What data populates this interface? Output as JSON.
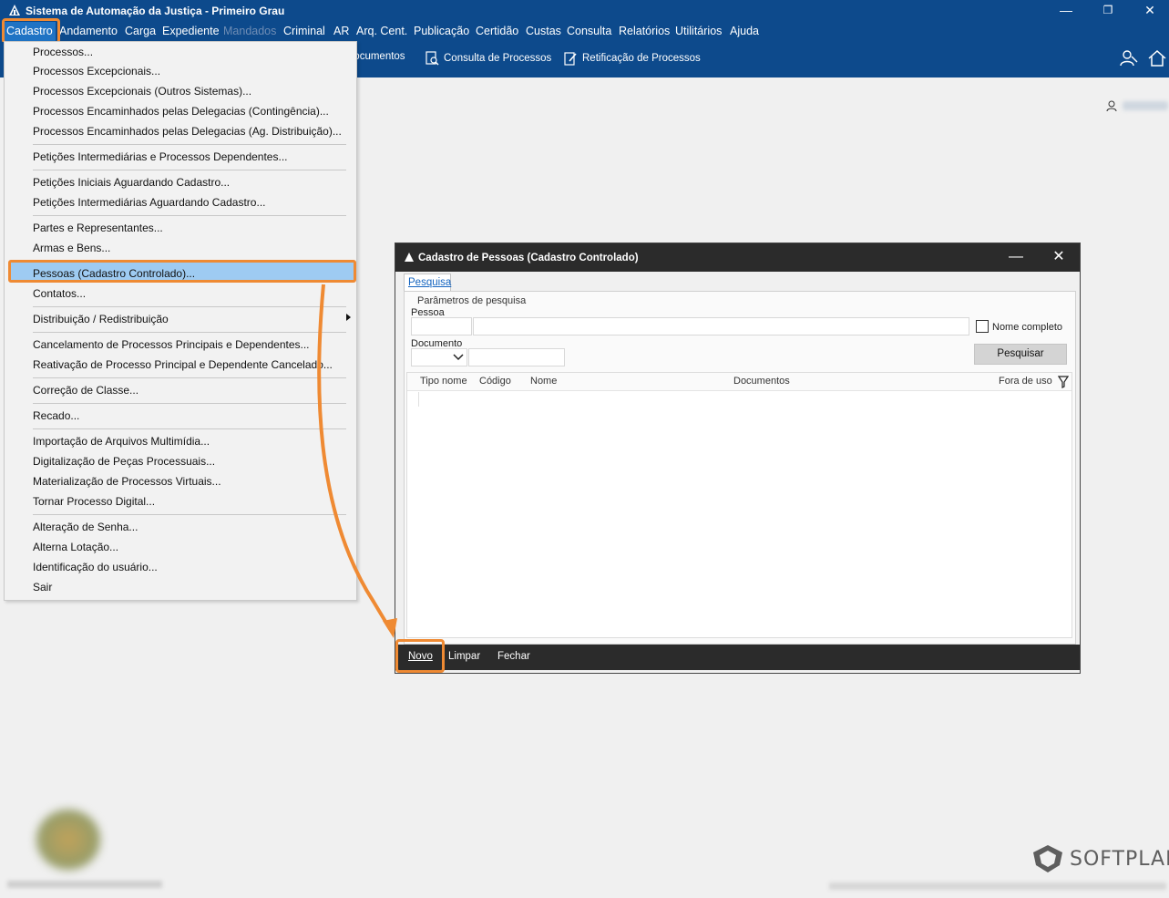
{
  "window": {
    "title": "Sistema de Automação da Justiça - Primeiro Grau",
    "controls": [
      "—",
      "❐",
      "✕"
    ]
  },
  "menubar": {
    "items": [
      "Cadastro",
      "Andamento",
      "Carga",
      "Expediente",
      "Mandados",
      "Criminal",
      "AR",
      "Arq. Cent.",
      "Publicação",
      "Certidão",
      "Custas",
      "Consulta",
      "Relatórios",
      "Utilitários",
      "Ajuda"
    ]
  },
  "toolbar": {
    "items": [
      "Documentos",
      "Consulta de Processos",
      "Retificação de Processos"
    ]
  },
  "dropdown": {
    "items": [
      "Processos...",
      "Processos Excepcionais...",
      "Processos Excepcionais (Outros Sistemas)...",
      "Processos Encaminhados pelas Delegacias (Contingência)...",
      "Processos Encaminhados pelas Delegacias (Ag. Distribuição)...",
      "Petições Intermediárias e Processos Dependentes...",
      "Petições Iniciais Aguardando Cadastro...",
      "Petições Intermediárias Aguardando Cadastro...",
      "Partes e Representantes...",
      "Armas e Bens...",
      "Pessoas (Cadastro Controlado)...",
      "Contatos...",
      "Distribuição / Redistribuição",
      "Cancelamento de Processos Principais e Dependentes...",
      "Reativação de Processo Principal e Dependente Cancelado...",
      "Correção de Classe...",
      "Recado...",
      "Importação de Arquivos Multimídia...",
      "Digitalização de Peças Processuais...",
      "Materialização de Processos Virtuais...",
      "Tornar Processo Digital...",
      "Alteração de Senha...",
      "Alterna Lotação...",
      "Identificação do usuário...",
      "Sair"
    ]
  },
  "dialog": {
    "title": "Cadastro de Pessoas (Cadastro Controlado)",
    "tab": "Pesquisa",
    "group": "Parâmetros de pesquisa",
    "pessoa_label": "Pessoa",
    "documento_label": "Documento",
    "nome_completo": "Nome completo",
    "pesquisar": "Pesquisar",
    "columns": [
      "Tipo nome",
      "Código",
      "Nome",
      "Documentos",
      "Fora de uso"
    ],
    "footer": [
      "Novo",
      "Limpar",
      "Fechar"
    ]
  },
  "brand": "SOFTPLAN",
  "colors": {
    "accent": "#ef8a33",
    "bar": "#0d4a8c"
  }
}
